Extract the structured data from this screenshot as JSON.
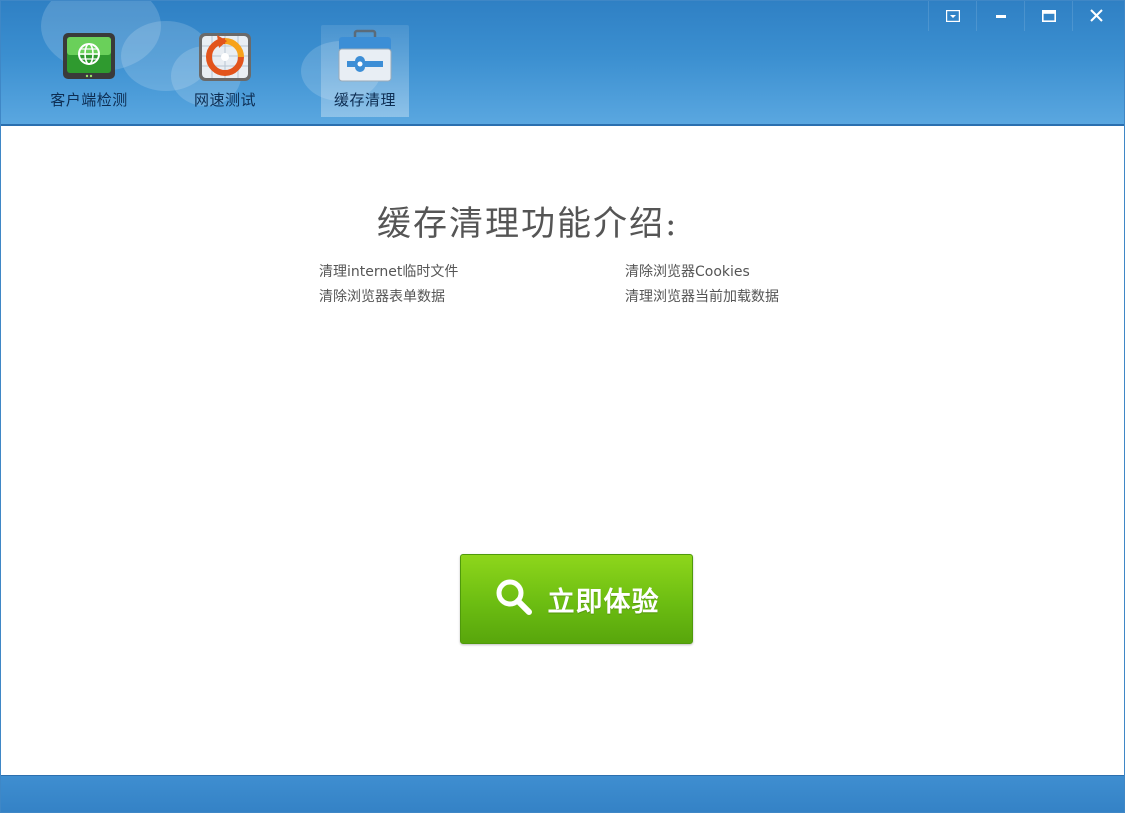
{
  "tabs": [
    {
      "label": "客户端检测",
      "icon": "monitor-globe-icon"
    },
    {
      "label": "网速测试",
      "icon": "speed-refresh-icon"
    },
    {
      "label": "缓存清理",
      "icon": "toolbox-wrench-icon"
    }
  ],
  "active_tab": 2,
  "window_controls": {
    "menu_icon": "dropdown-menu-icon",
    "minimize_icon": "minimize-icon",
    "maximize_icon": "maximize-icon",
    "close_icon": "close-icon"
  },
  "main": {
    "title": "缓存清理功能介绍:",
    "features": [
      "清理internet临时文件",
      "清除浏览器Cookies",
      "清除浏览器表单数据",
      "清理浏览器当前加载数据"
    ],
    "cta_label": "立即体验",
    "cta_icon": "search-icon"
  },
  "colors": {
    "accent": "#3b8fd0",
    "button_green": "#6cbd12"
  }
}
